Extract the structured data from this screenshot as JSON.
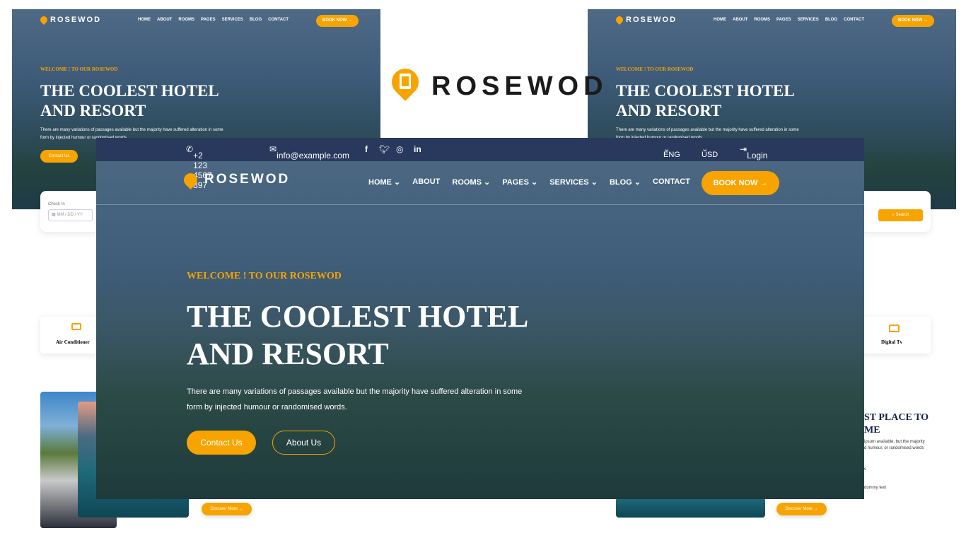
{
  "brand": {
    "name": "ROSEWOD",
    "accent": "#f7a400",
    "navy": "#29395d"
  },
  "topbar": {
    "phone": "+2 123 4567 897",
    "email": "info@example.com",
    "socials": [
      "facebook-icon",
      "twitter-icon",
      "instagram-icon",
      "linkedin-icon"
    ],
    "language": "ENG",
    "currency": "USD",
    "login": "Login"
  },
  "nav": {
    "items": [
      {
        "label": "HOME",
        "dropdown": true
      },
      {
        "label": "ABOUT",
        "dropdown": false
      },
      {
        "label": "ROOMS",
        "dropdown": true
      },
      {
        "label": "PAGES",
        "dropdown": true
      },
      {
        "label": "SERVICES",
        "dropdown": true
      },
      {
        "label": "BLOG",
        "dropdown": true
      },
      {
        "label": "CONTACT",
        "dropdown": false
      }
    ],
    "book_now": "BOOK NOW"
  },
  "hero": {
    "welcome": "WELCOME ! TO OUR ROSEWOD",
    "title_line1": "THE COOLEST HOTEL",
    "title_line2": "AND RESORT",
    "paragraph_line1": "There are many variations of passages available but the majority have suffered alteration in some",
    "paragraph_line2": "form by injected humour or randomised words.",
    "contact_btn": "Contact Us",
    "about_btn": "About Us"
  },
  "background_pages": {
    "check_in_label": "Check In",
    "date_placeholder": "MM / DD / YY",
    "search_btn": "Search",
    "feature_left": "Air Conditioner",
    "feature_right": "Digital Tv",
    "about_title_line1": "ST PLACE TO",
    "about_title_line2": "ME",
    "about_text_line1": "ipsum available, but the majority",
    "about_text_line2": "d humour, or randomised words",
    "list_fragment_1": "s",
    "list_fragment_2": "dummy text",
    "discover_btn": "Discover More"
  }
}
